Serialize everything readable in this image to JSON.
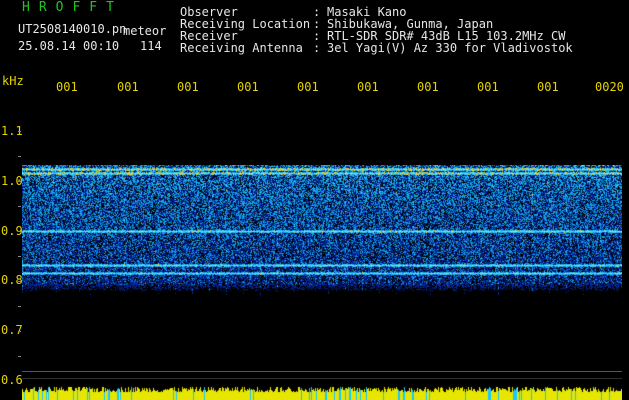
{
  "header": {
    "brand": "HROFFT",
    "filename": "UT2508140010.pn",
    "mode": "meteor",
    "datetime": "25.08.14 00:10",
    "count": "114"
  },
  "info": [
    {
      "label": "Observer",
      "value": "Masaki Kano"
    },
    {
      "label": "Receiving Location",
      "value": "Shibukawa, Gunma, Japan"
    },
    {
      "label": "Receiver",
      "value": "RTL-SDR SDR# 43dB L15 103.2MHz CW"
    },
    {
      "label": "Receiving Antenna",
      "value": "3el Yagi(V) Az 330 for Vladivostok"
    }
  ],
  "info_separator": ":",
  "yaxis": {
    "unit": "kHz",
    "ticks": [
      "1.1",
      "1.0",
      "0.9",
      "0.8",
      "0.7",
      "0.6"
    ]
  },
  "xaxis": {
    "ticks": [
      "001",
      "001",
      "001",
      "001",
      "001",
      "001",
      "001",
      "001",
      "001",
      "0020"
    ]
  },
  "colors": {
    "background": "#000000",
    "brand": "#22c422",
    "text": "#e6e6e6",
    "axis_labels": "#e6d400",
    "signal_low": "#0a1e8c",
    "signal_mid": "#2a6cff",
    "signal_high": "#3fe0ff",
    "level_bar": "#e6e600",
    "level_bar_alt": "#19c8ff"
  }
}
